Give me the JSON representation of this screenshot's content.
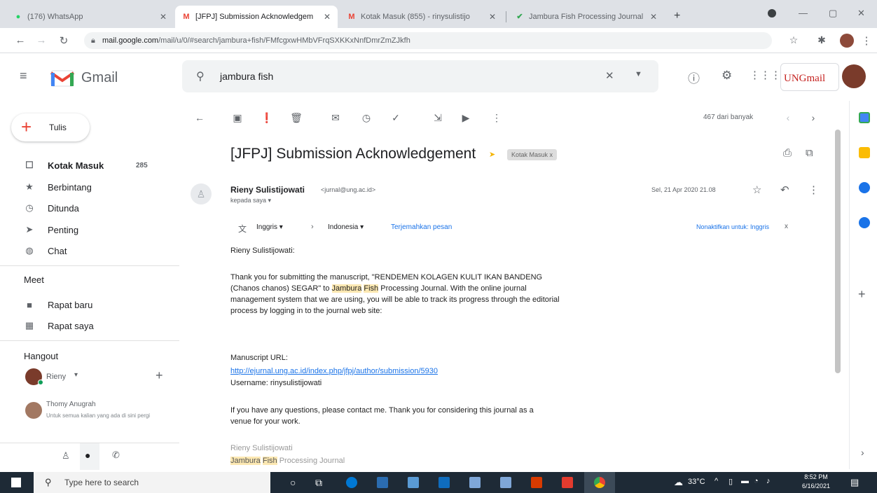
{
  "browser": {
    "tabs": [
      {
        "title": "(176) WhatsApp",
        "active": false
      },
      {
        "title": "[JFPJ] Submission Acknowledgem",
        "active": true
      },
      {
        "title": "Kotak Masuk (855) - rinysulistijo",
        "active": false
      },
      {
        "title": "Jambura Fish Processing Journal",
        "active": false
      }
    ],
    "new_tab": "+",
    "url_host": "mail.google.com",
    "url_path": "/mail/u/0/#search/jambura+fish/FMfcgxwHMbVFrqSXKKxNnfDmrZmZJkfh"
  },
  "gmail": {
    "logo_text": "Gmail",
    "search_query": "jambura fish",
    "org_logo_text": "UNGmail"
  },
  "sidebar": {
    "compose_label": "Tulis",
    "items": [
      {
        "label": "Kotak Masuk",
        "count": "285",
        "icon": "inbox-icon"
      },
      {
        "label": "Berbintang",
        "icon": "star-icon"
      },
      {
        "label": "Ditunda",
        "icon": "clock-icon"
      },
      {
        "label": "Penting",
        "icon": "label-important-icon"
      },
      {
        "label": "Chat",
        "icon": "chat-icon"
      }
    ],
    "meet_title": "Meet",
    "meet_items": [
      {
        "label": "Rapat baru",
        "icon": "video-icon"
      },
      {
        "label": "Rapat saya",
        "icon": "calendar-icon"
      }
    ],
    "hangout_title": "Hangout",
    "hangout_user": "Rieny",
    "contact_name": "Thomy Anugrah",
    "contact_status": "Untuk semua kalian yang ada di sini pergi"
  },
  "toolbar": {
    "pagination": "467 dari banyak"
  },
  "email": {
    "subject": "[JFPJ] Submission Acknowledgement",
    "label_chip": "Kotak Masuk",
    "sender_name": "Rieny Sulistijowati",
    "sender_email": "<jurnal@ung.ac.id>",
    "to_line": "kepada saya",
    "date": "Sel, 21 Apr 2020 21.08",
    "translate_from": "Inggris",
    "translate_to": "Indonesia",
    "translate_action": "Terjemahkan pesan",
    "translate_off": "Nonaktifkan untuk: Inggris",
    "greeting": "Rieny Sulistijowati:",
    "para1_a": "Thank you for submitting the manuscript, \"RENDEMEN KOLAGEN KULIT IKAN BANDENG (Chanos chanos) SEGAR\" to ",
    "hl_word1": "Jambura",
    "hl_word2": "Fish",
    "para1_b": " Processing Journal. With the online journal management system that we are using, you will be able to track its progress through the editorial process by logging in to the journal web site:",
    "manuscript_url_label": "Manuscript URL:",
    "manuscript_url": "http://ejurnal.ung.ac.id/index.php/jfpj/author/submission/5930",
    "username_line": "Username: rinysulistijowati",
    "para2": "If you have any questions, please contact me. Thank you for considering this journal as a venue for your work.",
    "signature_name": "Rieny Sulistijowati",
    "signature_journal_rest": " Processing Journal"
  },
  "taskbar": {
    "search_placeholder": "Type here to search",
    "weather": "33°C",
    "time": "8:52 PM",
    "date": "6/16/2021"
  },
  "colors": {
    "gmail_red": "#ea4335",
    "highlight": "#fce8b2",
    "link_blue": "#1a73e8",
    "label_chip": "#ddd",
    "taskbar_bg": "#1e2a36"
  }
}
